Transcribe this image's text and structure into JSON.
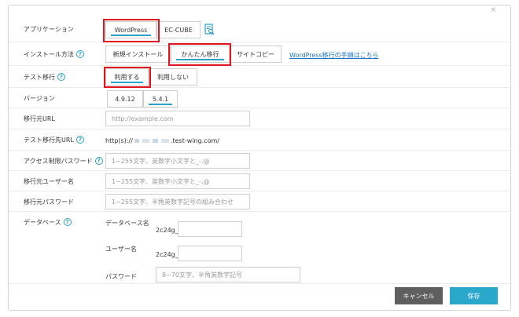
{
  "form": {
    "close_glyph": "×",
    "application": {
      "label": "アプリケーション",
      "options": [
        "WordPress",
        "EC-CUBE"
      ],
      "selected": "WordPress",
      "icon": "search-document-icon"
    },
    "install_method": {
      "label": "インストール方法",
      "options": [
        "新規インストール",
        "かんたん移行",
        "サイトコピー"
      ],
      "selected": "かんたん移行",
      "link": "WordPress移行の手順はこちら"
    },
    "test_migration": {
      "label": "テスト移行",
      "options": [
        "利用する",
        "利用しない"
      ],
      "selected": "利用する"
    },
    "version": {
      "label": "バージョン",
      "options": [
        "4.9.12",
        "5.4.1"
      ],
      "selected": "5.4.1"
    },
    "source_url": {
      "label": "移行元URL",
      "placeholder": "http://example.com"
    },
    "test_url": {
      "label": "テスト移行先URL",
      "prefix": "http(s)://",
      "suffix": ".test-wing.com/"
    },
    "access_password": {
      "label": "アクセス制限パスワード",
      "placeholder": "1~255文字、英数字小文字と_-.@"
    },
    "source_user": {
      "label": "移行元ユーザー名",
      "placeholder": "1~255文字、英数字小文字と_-.@"
    },
    "source_password": {
      "label": "移行元パスワード",
      "placeholder": "1~255文字、半角英数字記号の組み合わせ"
    },
    "database": {
      "label": "データベース",
      "db_name_label": "データベース名",
      "db_name_prefix": "2c24g_",
      "user_label": "ユーザー名",
      "user_prefix": "2c24g_",
      "password_label": "パスワード",
      "password_placeholder": "8~70文字、半角英数字記号"
    },
    "buttons": {
      "cancel": "キャンセル",
      "save": "保存"
    }
  }
}
